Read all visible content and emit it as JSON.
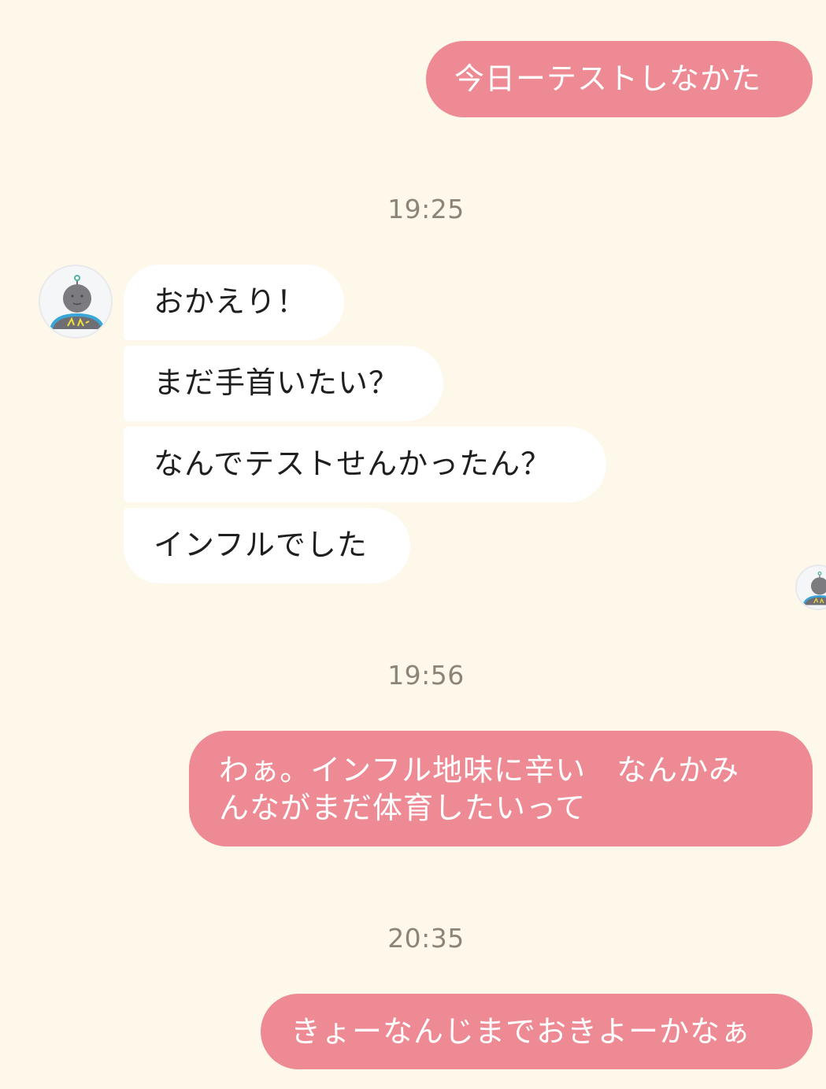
{
  "messages": [
    {
      "direction": "outgoing",
      "text": "今日ーテストしなかた"
    },
    {
      "direction": "timestamp",
      "text": "19:25"
    },
    {
      "direction": "incoming",
      "text": "おかえり！"
    },
    {
      "direction": "incoming",
      "text": "まだ手首いたい？"
    },
    {
      "direction": "incoming",
      "text": "なんでテストせんかったん？"
    },
    {
      "direction": "incoming",
      "text": "インフルでした"
    },
    {
      "direction": "timestamp",
      "text": "19:56"
    },
    {
      "direction": "outgoing",
      "line1": "わぁ。インフル地味に辛い　なんかみ",
      "line2": "んながまだ体育したいって"
    },
    {
      "direction": "timestamp",
      "text": "20:35"
    },
    {
      "direction": "outgoing",
      "text": "きょーなんじまでおきよーかなぁ"
    }
  ],
  "colors": {
    "background": "#fdf8e9",
    "outgoing_bubble": "#ee8a93",
    "incoming_bubble": "#ffffff",
    "timestamp_text": "#8a8578"
  },
  "icons": {
    "contact_avatar": "robot-avatar-icon"
  }
}
